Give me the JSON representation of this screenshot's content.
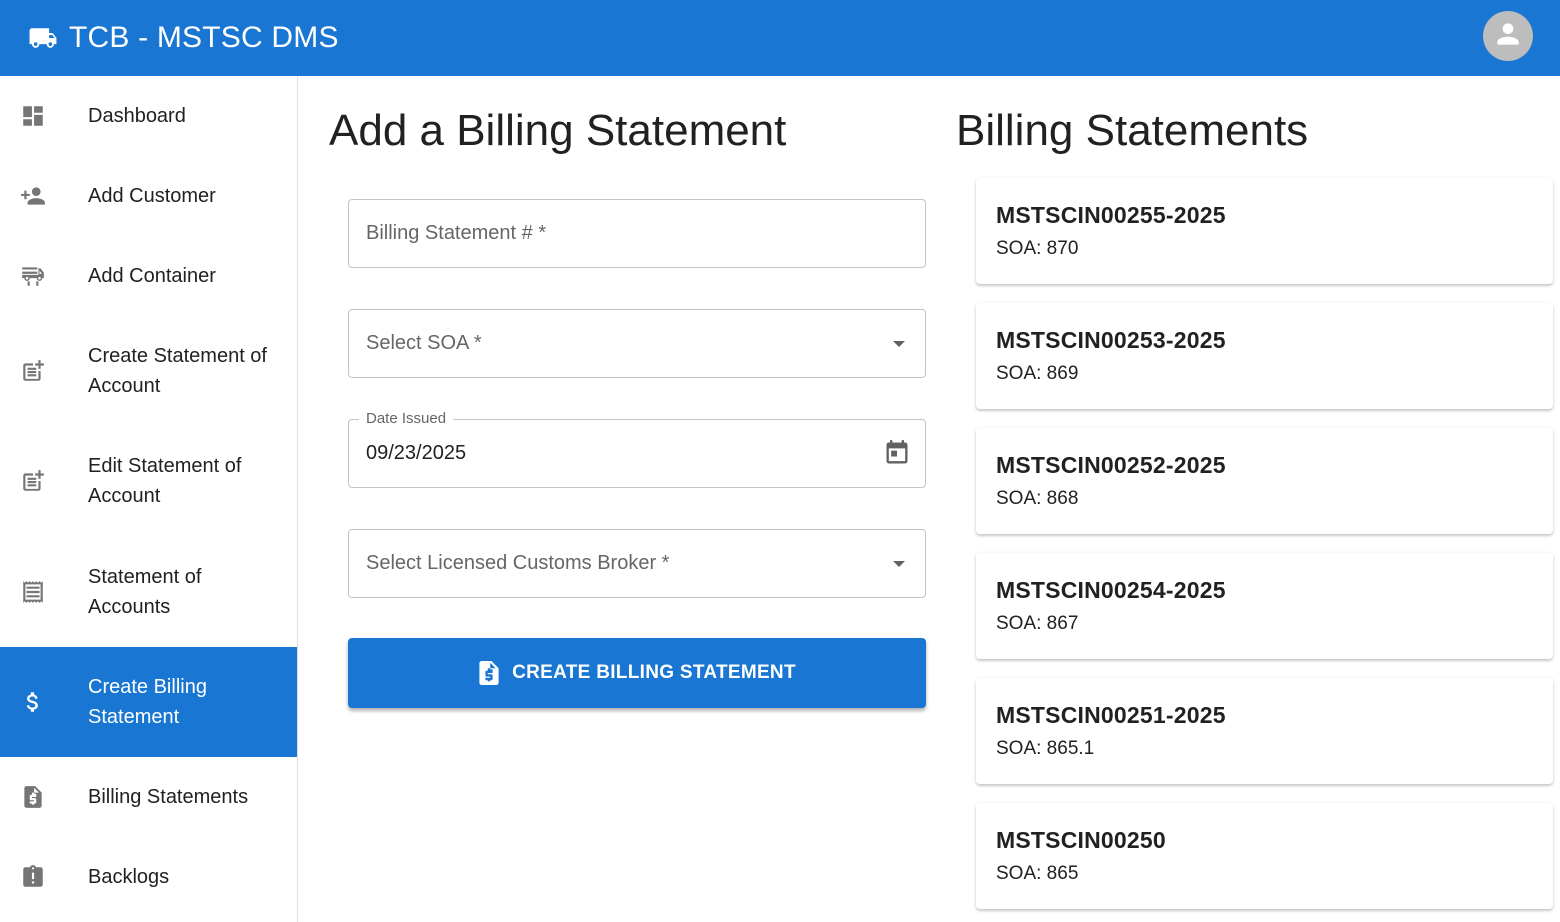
{
  "app": {
    "title": "TCB - MSTSC DMS"
  },
  "sidebar": {
    "items": [
      {
        "label": "Dashboard",
        "icon": "dashboard-icon"
      },
      {
        "label": "Add Customer",
        "icon": "person-add-icon"
      },
      {
        "label": "Add Container",
        "icon": "container-truck-icon"
      },
      {
        "label": "Create Statement of Account",
        "icon": "post-add-icon"
      },
      {
        "label": "Edit Statement of Account",
        "icon": "post-add-icon"
      },
      {
        "label": "Statement of Accounts",
        "icon": "receipt-icon"
      },
      {
        "label": "Create Billing Statement",
        "icon": "dollar-icon",
        "active": true
      },
      {
        "label": "Billing Statements",
        "icon": "request-quote-icon"
      },
      {
        "label": "Backlogs",
        "icon": "assignment-late-icon"
      }
    ]
  },
  "form": {
    "heading": "Add a Billing Statement",
    "billing_no_placeholder": "Billing Statement # *",
    "soa_placeholder": "Select SOA *",
    "date_label": "Date Issued",
    "date_value": "09/23/2025",
    "broker_placeholder": "Select Licensed Customs Broker *",
    "submit_label": "CREATE BILLING STATEMENT"
  },
  "list": {
    "heading": "Billing Statements",
    "items": [
      {
        "title": "MSTSCIN00255-2025",
        "soa": "SOA: 870"
      },
      {
        "title": "MSTSCIN00253-2025",
        "soa": "SOA: 869"
      },
      {
        "title": "MSTSCIN00252-2025",
        "soa": "SOA: 868"
      },
      {
        "title": "MSTSCIN00254-2025",
        "soa": "SOA: 867"
      },
      {
        "title": "MSTSCIN00251-2025",
        "soa": "SOA: 865.1"
      },
      {
        "title": "MSTSCIN00250",
        "soa": "SOA: 865"
      }
    ]
  },
  "colors": {
    "primary": "#1976d2",
    "avatar_bg": "#bdbdbd"
  }
}
